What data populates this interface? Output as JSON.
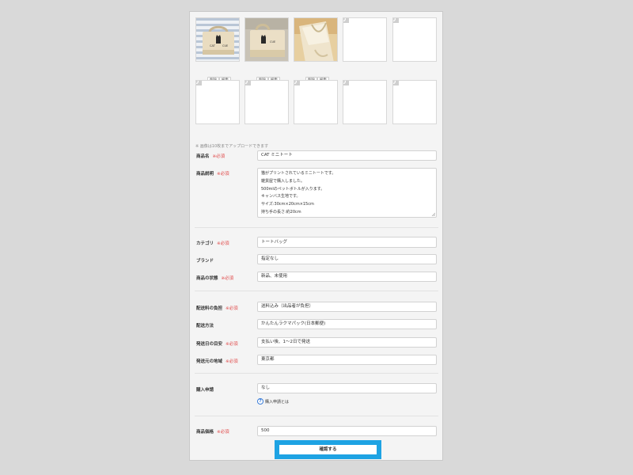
{
  "photos": {
    "thumb_buttons": [
      {
        "delete_label": "削除",
        "edit_label": "編集"
      },
      {
        "delete_label": "削除",
        "edit_label": "編集"
      },
      {
        "delete_label": "削除",
        "edit_label": "編集"
      }
    ],
    "photo_texts": [
      "CAT",
      "CUE"
    ],
    "note": "※ 画像は10枚までアップロードできます",
    "placeholder_icon": "camera-icon"
  },
  "required_text": "※必須",
  "fields": {
    "name": {
      "label": "商品名",
      "value": "CAT ミニトート"
    },
    "description": {
      "label": "商品説明",
      "lines": [
        "猫がプリントされているミニトートです。",
        "雑貨屋で購入しました。",
        "500mlのペットボトルが入ります。",
        "キャンバス生地です。",
        "サイズ:30cm×20cm×15cm",
        "持ち手の長さ:約20cm"
      ]
    },
    "category": {
      "label": "カテゴリ",
      "value": "トートバッグ"
    },
    "brand": {
      "label": "ブランド",
      "value": "指定なし"
    },
    "condition": {
      "label": "商品の状態",
      "value": "新品、未使用"
    },
    "shipping_fee": {
      "label": "配送料の負担",
      "value": "送料込み（出品者が負担）"
    },
    "shipping_method": {
      "label": "配送方法",
      "value": "かんたんラクマパック(日本郵便)"
    },
    "ship_days": {
      "label": "発送日の目安",
      "value": "支払い後、1〜2日で発送"
    },
    "ship_from": {
      "label": "発送元の地域",
      "value": "東京都"
    },
    "purchase_request": {
      "label": "購入申請",
      "value": "なし",
      "help": "購入申請とは"
    },
    "price": {
      "label": "商品価格",
      "value": "500"
    }
  },
  "submit_label": "確認する",
  "colors": {
    "accent": "#1ea3e3",
    "required": "#e04848",
    "help_icon": "#3b7dd8"
  }
}
